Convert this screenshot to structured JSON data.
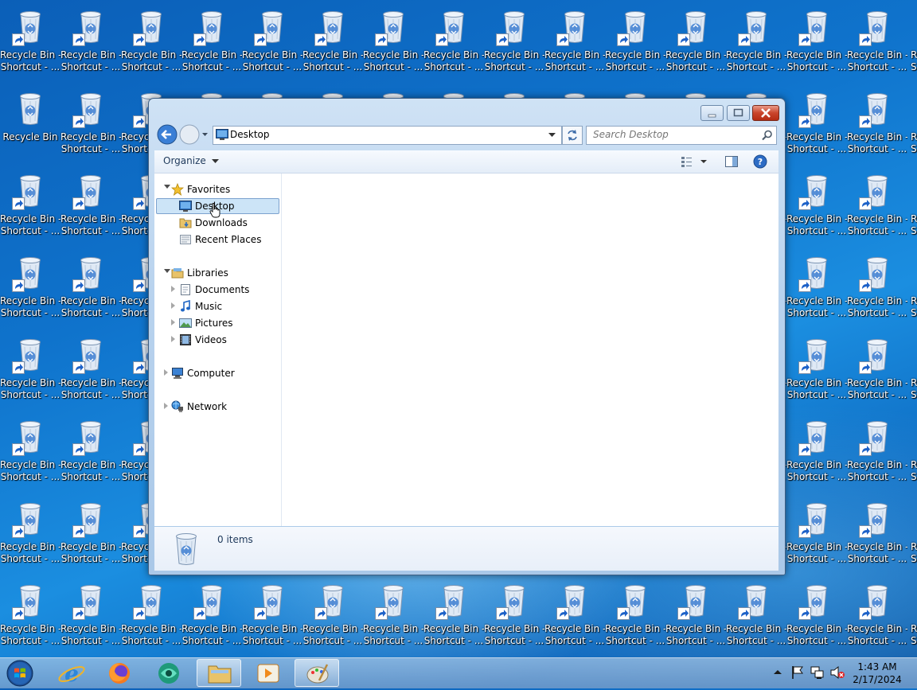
{
  "desktop": {
    "icon_labels": {
      "recycle_bin": "Recycle Bin",
      "shortcut_line1": "Recycle Bin -",
      "shortcut_line2": "Shortcut - ...",
      "partial_line1": "R",
      "partial_line2": "S"
    }
  },
  "window": {
    "address": {
      "location": "Desktop"
    },
    "search": {
      "placeholder": "Search Desktop"
    },
    "toolbar": {
      "organize_label": "Organize"
    },
    "nav": {
      "favorites": "Favorites",
      "favorites_items": [
        "Desktop",
        "Downloads",
        "Recent Places"
      ],
      "libraries": "Libraries",
      "libraries_items": [
        "Documents",
        "Music",
        "Pictures",
        "Videos"
      ],
      "computer": "Computer",
      "network": "Network",
      "selected": "Desktop"
    },
    "details": {
      "item_count": "0 items"
    }
  },
  "taskbar": {
    "clock": {
      "time": "1:43 AM",
      "date": "2/17/2024"
    }
  },
  "icons": {
    "back": "back-arrow-icon",
    "forward": "forward-arrow-icon",
    "refresh": "refresh-icon",
    "search": "magnifier-icon",
    "help": "help-icon"
  },
  "colors": {
    "desktop_bg": "#0f73cc",
    "close_button": "#c9442b",
    "selection": "#cce4f7"
  }
}
